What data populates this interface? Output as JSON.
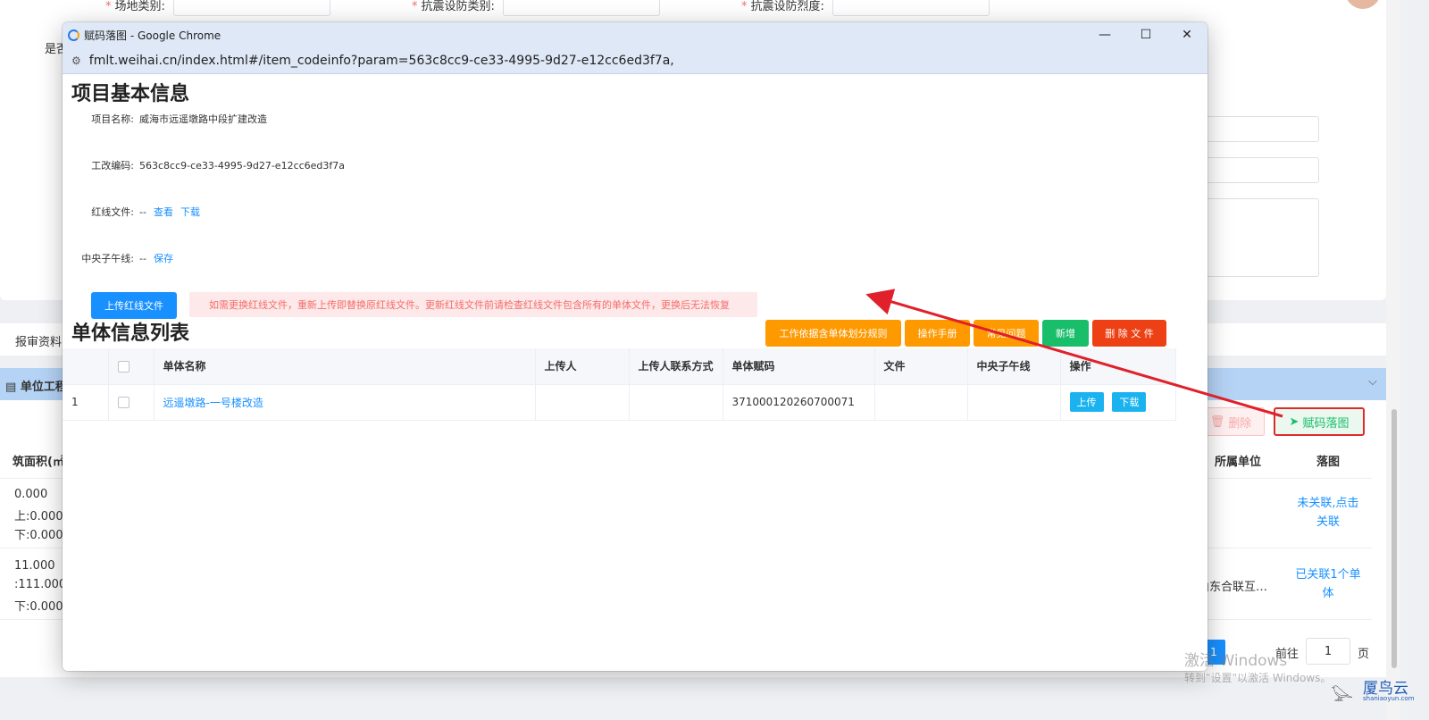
{
  "background": {
    "form_labels": [
      "场地类别:",
      "抗震设防类别:",
      "抗震设防烈度:"
    ],
    "partial_label_left": "是否",
    "tab_label": "报审资料",
    "section_header": "单位工程",
    "delete_button": "删除",
    "assign_map_button": "赋码落图",
    "col_area": "筑面积(㎡)",
    "col_unit": "所属单位",
    "col_map": "落图",
    "rows": [
      {
        "line1": "0.000",
        "line2": "上:0.000",
        "line3": "下:0.000",
        "unit": "",
        "status": "未关联,点击关联"
      },
      {
        "line1": "11.000",
        "line2": ":111.000",
        "line3": "下:0.000",
        "unit": "山东合联互…",
        "status": "已关联1个单体"
      }
    ],
    "pagination": {
      "current": "1",
      "goto_label": "前往",
      "goto_value": "1",
      "page_label": "页"
    }
  },
  "popup": {
    "window_title": "赋码落图 - Google Chrome",
    "url": "fmlt.weihai.cn/index.html#/item_codeinfo?param=563c8cc9-ce33-4995-9d27-e12cc6ed3f7a,",
    "section1_title": "项目基本信息",
    "fields": {
      "name_label": "项目名称:",
      "name_value": "威海市远遥墩路中段扩建改造",
      "code_label": "工改编码:",
      "code_value": "563c8cc9-ce33-4995-9d27-e12cc6ed3f7a",
      "redline_label": "红线文件:",
      "redline_value": "--",
      "redline_view": "查看",
      "redline_download": "下载",
      "meridian_label": "中央子午线:",
      "meridian_value": "--",
      "meridian_save": "保存"
    },
    "upload_redline_button": "上传红线文件",
    "notice": "如需更换红线文件，重新上传即替换原红线文件。更新红线文件前请检查红线文件包含所有的单体文件，更换后无法恢复",
    "section2_title": "单体信息列表",
    "toolbar": {
      "rules": "工作依据含单体划分规则",
      "manual": "操作手册",
      "faq": "常见问题",
      "add": "新增",
      "delete_file": "删 除 文 件"
    },
    "table": {
      "headers": [
        "",
        "",
        "单体名称",
        "上传人",
        "上传人联系方式",
        "单体赋码",
        "文件",
        "中央子午线",
        "操作"
      ],
      "rows": [
        {
          "index": "1",
          "name": "远遥墩路-一号楼改造",
          "uploader": "",
          "contact": "",
          "code": "371000120260700071",
          "file": "",
          "meridian": "",
          "upload": "上传",
          "download": "下载"
        }
      ]
    }
  },
  "watermark": {
    "line1": "激活 Windows",
    "line2": "转到\"设置\"以激活 Windows。",
    "brand": "厦鸟云",
    "brand_sub": "shaniaoyun.com"
  },
  "colors": {
    "primary": "#1890ff",
    "orange": "#ff9900",
    "green": "#19be6b",
    "red": "#ed4014",
    "arrow": "#e0202a"
  }
}
